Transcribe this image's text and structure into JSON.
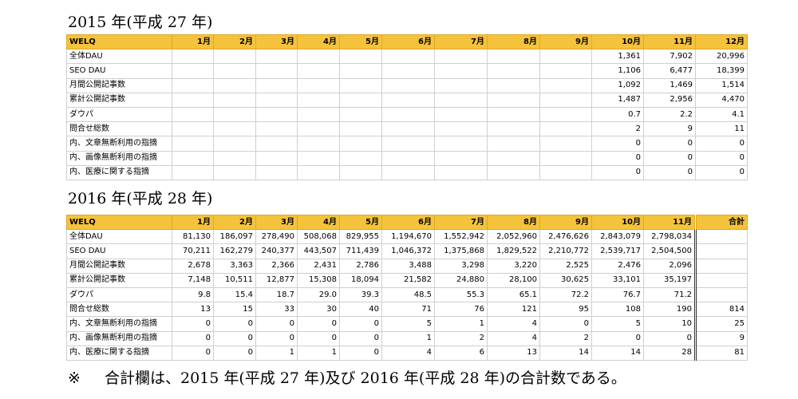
{
  "section_2015": {
    "title": "2015 年(平成 27 年)",
    "headers": [
      "WELQ",
      "1月",
      "2月",
      "3月",
      "4月",
      "5月",
      "6月",
      "7月",
      "8月",
      "9月",
      "10月",
      "11月",
      "12月"
    ],
    "rows": [
      {
        "label": "全体DAU",
        "values": [
          "",
          "",
          "",
          "",
          "",
          "",
          "",
          "",
          "",
          "1,361",
          "7,902",
          "20,996"
        ]
      },
      {
        "label": "SEO DAU",
        "values": [
          "",
          "",
          "",
          "",
          "",
          "",
          "",
          "",
          "",
          "1,106",
          "6,477",
          "18,399"
        ]
      },
      {
        "label": "月間公開記事数",
        "values": [
          "",
          "",
          "",
          "",
          "",
          "",
          "",
          "",
          "",
          "1,092",
          "1,469",
          "1,514"
        ]
      },
      {
        "label": "累計公開記事数",
        "values": [
          "",
          "",
          "",
          "",
          "",
          "",
          "",
          "",
          "",
          "1,487",
          "2,956",
          "4,470"
        ]
      },
      {
        "label": "ダウパ",
        "values": [
          "",
          "",
          "",
          "",
          "",
          "",
          "",
          "",
          "",
          "0.7",
          "2.2",
          "4.1"
        ]
      },
      {
        "label": "問合せ総数",
        "values": [
          "",
          "",
          "",
          "",
          "",
          "",
          "",
          "",
          "",
          "2",
          "9",
          "11"
        ]
      },
      {
        "label": "内、文章無断利用の指摘",
        "values": [
          "",
          "",
          "",
          "",
          "",
          "",
          "",
          "",
          "",
          "0",
          "0",
          "0"
        ]
      },
      {
        "label": "内、画像無断利用の指摘",
        "values": [
          "",
          "",
          "",
          "",
          "",
          "",
          "",
          "",
          "",
          "0",
          "0",
          "0"
        ]
      },
      {
        "label": "内、医療に関する指摘",
        "values": [
          "",
          "",
          "",
          "",
          "",
          "",
          "",
          "",
          "",
          "0",
          "0",
          "0"
        ]
      }
    ]
  },
  "section_2016": {
    "title": "2016 年(平成 28 年)",
    "headers": [
      "WELQ",
      "1月",
      "2月",
      "3月",
      "4月",
      "5月",
      "6月",
      "7月",
      "8月",
      "9月",
      "10月",
      "11月",
      "合計"
    ],
    "rows": [
      {
        "label": "全体DAU",
        "values": [
          "81,130",
          "186,097",
          "278,490",
          "508,068",
          "829,955",
          "1,194,670",
          "1,552,942",
          "2,052,960",
          "2,476,626",
          "2,843,079",
          "2,798,034",
          ""
        ]
      },
      {
        "label": "SEO DAU",
        "values": [
          "70,211",
          "162,279",
          "240,377",
          "443,507",
          "711,439",
          "1,046,372",
          "1,375,868",
          "1,829,522",
          "2,210,772",
          "2,539,717",
          "2,504,500",
          ""
        ]
      },
      {
        "label": "月間公開記事数",
        "values": [
          "2,678",
          "3,363",
          "2,366",
          "2,431",
          "2,786",
          "3,488",
          "3,298",
          "3,220",
          "2,525",
          "2,476",
          "2,096",
          ""
        ]
      },
      {
        "label": "累計公開記事数",
        "values": [
          "7,148",
          "10,511",
          "12,877",
          "15,308",
          "18,094",
          "21,582",
          "24,880",
          "28,100",
          "30,625",
          "33,101",
          "35,197",
          ""
        ]
      },
      {
        "label": "ダウパ",
        "values": [
          "9.8",
          "15.4",
          "18.7",
          "29.0",
          "39.3",
          "48.5",
          "55.3",
          "65.1",
          "72.2",
          "76.7",
          "71.2",
          ""
        ]
      },
      {
        "label": "問合せ総数",
        "values": [
          "13",
          "15",
          "33",
          "30",
          "40",
          "71",
          "76",
          "121",
          "95",
          "108",
          "190",
          "814"
        ]
      },
      {
        "label": "内、文章無断利用の指摘",
        "values": [
          "0",
          "0",
          "0",
          "0",
          "0",
          "5",
          "1",
          "4",
          "0",
          "5",
          "10",
          "25"
        ]
      },
      {
        "label": "内、画像無断利用の指摘",
        "values": [
          "0",
          "0",
          "0",
          "0",
          "0",
          "1",
          "2",
          "4",
          "2",
          "0",
          "0",
          "9"
        ]
      },
      {
        "label": "内、医療に関する指摘",
        "values": [
          "0",
          "0",
          "1",
          "1",
          "0",
          "4",
          "6",
          "13",
          "14",
          "14",
          "28",
          "81"
        ]
      }
    ]
  },
  "footnote": {
    "mark": "※",
    "text": "合計欄は、2015 年(平成 27 年)及び 2016 年(平成 28 年)の合計数である。"
  },
  "colors": {
    "header_bg": "#f5c33b",
    "border": "#cfcfcf"
  }
}
